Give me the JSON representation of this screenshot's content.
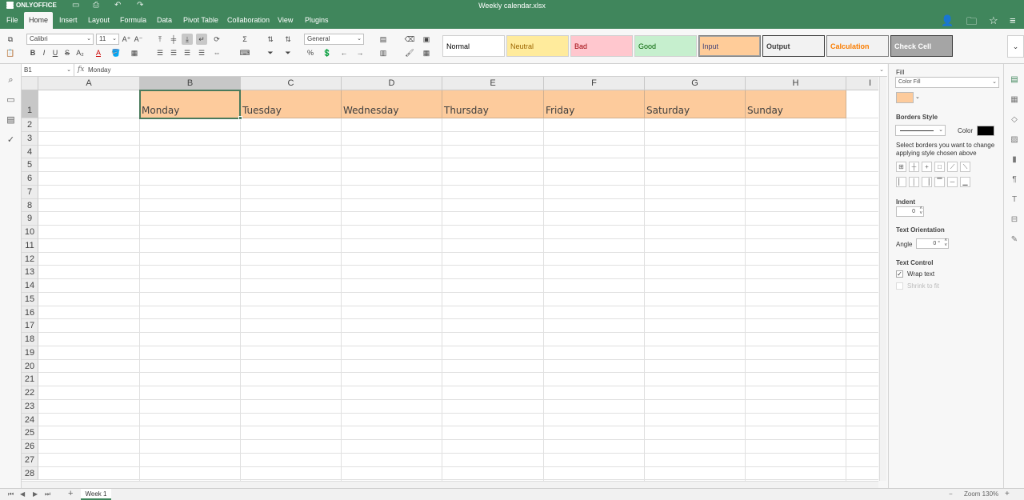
{
  "title_bar": {
    "logo": "ONLYOFFICE",
    "doc_title": "Weekly calendar.xlsx",
    "icons": [
      "save-icon",
      "print-icon",
      "undo-icon",
      "redo-icon"
    ]
  },
  "menu": {
    "tabs": [
      "File",
      "Home",
      "Insert",
      "Layout",
      "Formula",
      "Data",
      "Pivot Table",
      "Collaboration",
      "View",
      "Plugins"
    ],
    "active_tab": "Home",
    "right_icons": [
      "add-user-icon",
      "open-folder-icon",
      "favorite-star-icon",
      "hamburger-menu-icon"
    ]
  },
  "toolbar": {
    "font_name": "Calibri",
    "font_size": "11",
    "number_format": "General",
    "sum_symbol": "Σ",
    "bold": "B",
    "italic": "I",
    "underline": "U",
    "strike": "S",
    "percent": "%",
    "font_color_glyph": "A"
  },
  "cell_styles": [
    {
      "name": "Normal",
      "bg": "#ffffff",
      "fg": "#000000",
      "bold": false,
      "border": "#d0d0d0"
    },
    {
      "name": "Neutral",
      "bg": "#ffeb9c",
      "fg": "#9c6500",
      "bold": false,
      "border": "#d0d0d0"
    },
    {
      "name": "Bad",
      "bg": "#ffc7ce",
      "fg": "#9c0006",
      "bold": false,
      "border": "#d0d0d0"
    },
    {
      "name": "Good",
      "bg": "#c6efce",
      "fg": "#006100",
      "bold": false,
      "border": "#d0d0d0"
    },
    {
      "name": "Input",
      "bg": "#ffcc99",
      "fg": "#3f3f76",
      "bold": false,
      "border": "#7f7f7f"
    },
    {
      "name": "Output",
      "bg": "#f2f2f2",
      "fg": "#3f3f3f",
      "bold": true,
      "border": "#3f3f3f"
    },
    {
      "name": "Calculation",
      "bg": "#f2f2f2",
      "fg": "#fa7d00",
      "bold": true,
      "border": "#7f7f7f"
    },
    {
      "name": "Check Cell",
      "bg": "#a5a5a5",
      "fg": "#ffffff",
      "bold": true,
      "border": "#3f3f3f"
    }
  ],
  "formula_bar": {
    "cell_ref": "B1",
    "fx": "fx",
    "content": "Monday"
  },
  "sheet": {
    "columns": [
      "A",
      "B",
      "C",
      "D",
      "E",
      "F",
      "G",
      "H",
      "I"
    ],
    "active_column": "B",
    "rows": [
      "1",
      "2",
      "3",
      "4",
      "5",
      "6",
      "7",
      "8",
      "9",
      "10",
      "11",
      "12",
      "13",
      "14",
      "15",
      "16",
      "17",
      "18",
      "19",
      "20",
      "21",
      "22",
      "23",
      "24",
      "25",
      "26",
      "27",
      "28"
    ],
    "active_row": "1",
    "row1_values": [
      "",
      "Monday",
      "Tuesday",
      "Wednesday",
      "Thursday",
      "Friday",
      "Saturday",
      "Sunday"
    ],
    "header_fill": "#fdcb9c"
  },
  "right_panel": {
    "fill_label": "Fill",
    "fill_type": "Color Fill",
    "fill_color": "#fdcb9c",
    "borders_style_label": "Borders Style",
    "color_label": "Color",
    "border_color": "#000000",
    "borders_hint": "Select borders you want to change applying style chosen above",
    "indent_label": "Indent",
    "indent_value": "0",
    "text_orientation_label": "Text Orientation",
    "angle_label": "Angle",
    "angle_value": "0 °",
    "text_control_label": "Text Control",
    "wrap_text": "Wrap text",
    "shrink_to_fit": "Shrink to fit"
  },
  "right_strip_icons": [
    "cell-settings-icon",
    "table-icon",
    "shape-icon",
    "image-icon",
    "chart-icon",
    "paragraph-icon",
    "text-art-icon",
    "pivot-icon",
    "signature-icon"
  ],
  "left_icons": [
    "search-icon",
    "comments-icon",
    "chat-icon",
    "spellcheck-icon"
  ],
  "status_bar": {
    "sheet_tab": "Week 1",
    "add_sheet": "+",
    "zoom_minus": "−",
    "zoom_label": "Zoom 130%",
    "zoom_plus": "+"
  }
}
